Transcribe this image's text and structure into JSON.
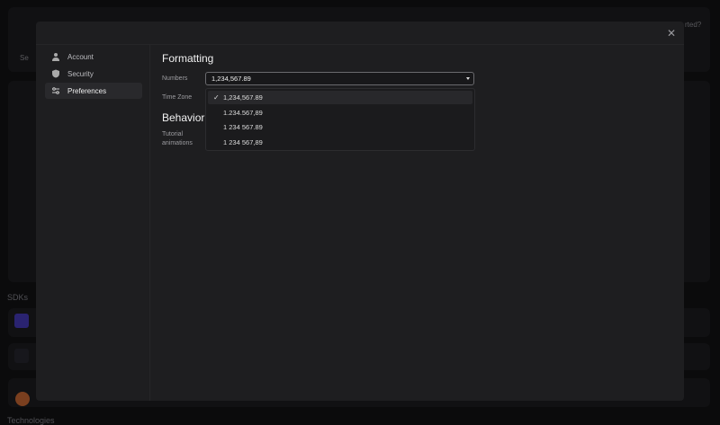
{
  "background": {
    "search_placeholder": "Se",
    "header_link": "rted?",
    "sdks_heading": "SDKs",
    "technologies_heading": "Technologies"
  },
  "sidebar": {
    "items": [
      {
        "label": "Account",
        "icon": "person-icon"
      },
      {
        "label": "Security",
        "icon": "shield-icon"
      },
      {
        "label": "Preferences",
        "icon": "sliders-icon",
        "active": true
      }
    ]
  },
  "formatting": {
    "title": "Formatting",
    "numbers_label": "Numbers",
    "numbers_value": "1,234,567.89",
    "timezone_label": "Time Zone",
    "options": [
      "1,234,567.89",
      "1.234.567,89",
      "1 234 567.89",
      "1 234 567,89"
    ],
    "selected_index": 0
  },
  "behavior": {
    "title": "Behavior",
    "tutorial_label_1": "Tutorial",
    "tutorial_label_2": "animations"
  }
}
